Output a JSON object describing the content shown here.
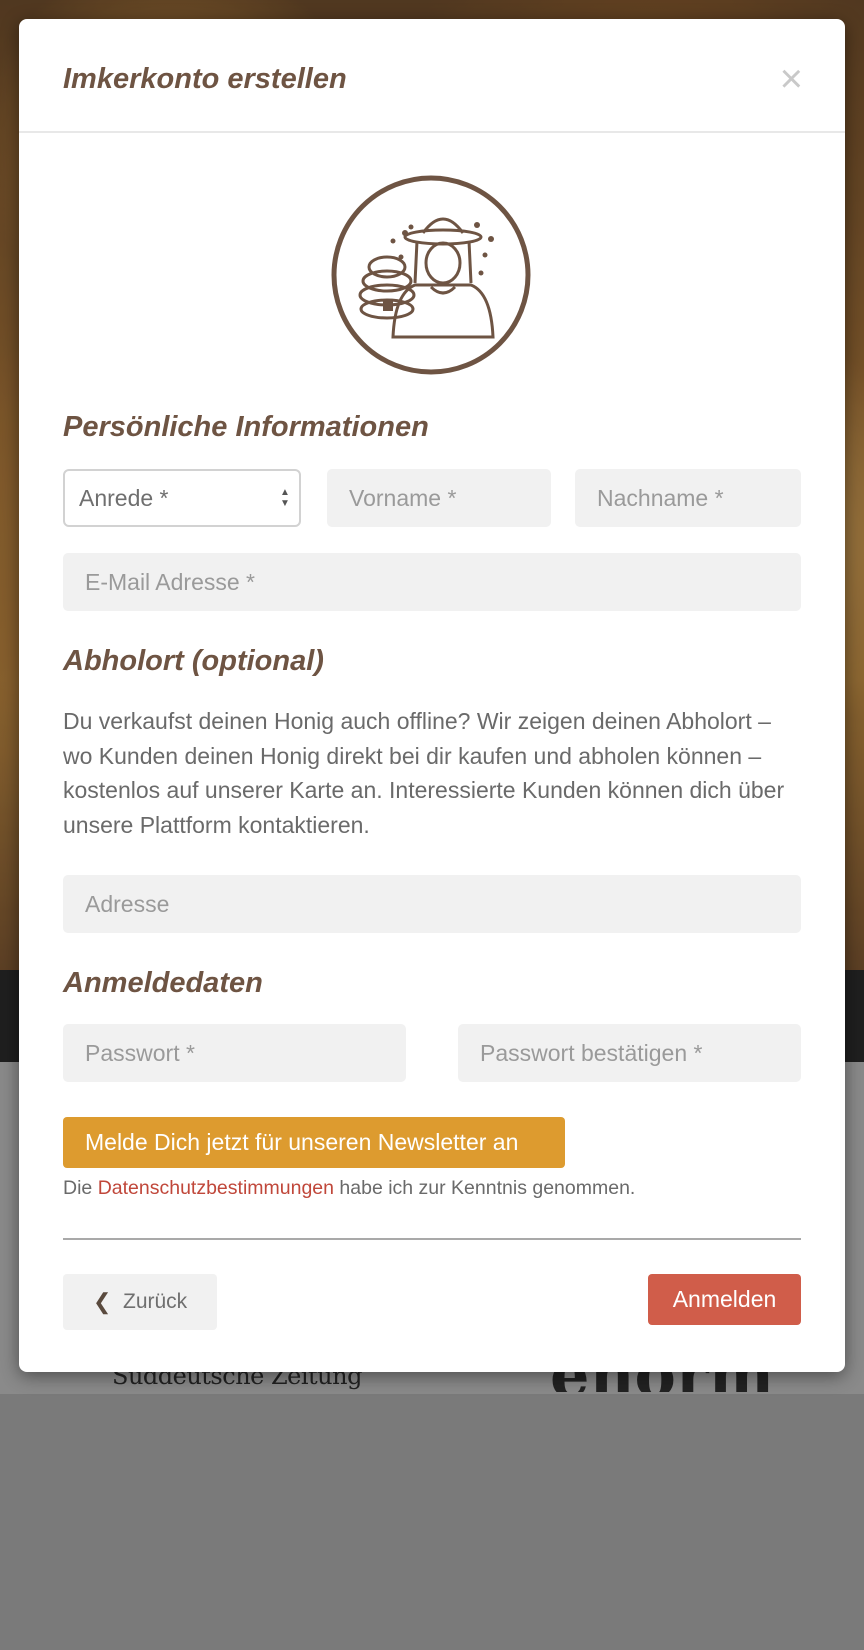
{
  "background": {
    "logo_left": "Süddeutsche Zeitung",
    "logo_right": "enorm"
  },
  "modal": {
    "title": "Imkerkonto erstellen",
    "close_glyph": "×",
    "avatar_icon": "beekeeper-icon",
    "sections": {
      "personal": "Persönliche Informationen",
      "pickup": "Abholort (optional)",
      "login": "Anmeldedaten"
    },
    "salutation": {
      "value": "Anrede *"
    },
    "fields": {
      "first_name_placeholder": "Vorname *",
      "last_name_placeholder": "Nachname *",
      "email_placeholder": "E-Mail Adresse *",
      "address_placeholder": "Adresse",
      "password_placeholder": "Passwort *",
      "password_confirm_placeholder": "Passwort bestätigen *"
    },
    "pickup_description": "Du verkaufst deinen Honig auch offline? Wir zeigen deinen Abholort – wo Kunden deinen Honig direkt bei dir kaufen und abholen können – kostenlos auf unserer Karte an. Interessierte Kunden können dich über unsere Plattform kontaktieren.",
    "newsletter_label": "Melde Dich jetzt für unseren Newsletter an",
    "privacy": {
      "prefix": "Die",
      "link": "Datenschutzbestimmungen",
      "suffix": "habe ich zur Kenntnis genommen."
    },
    "buttons": {
      "back": "Zurück",
      "submit": "Anmelden"
    },
    "colors": {
      "heading": "#6e5443",
      "newsletter": "#dd9b2f",
      "submit": "#d05d4a",
      "link": "#c0473a"
    }
  }
}
